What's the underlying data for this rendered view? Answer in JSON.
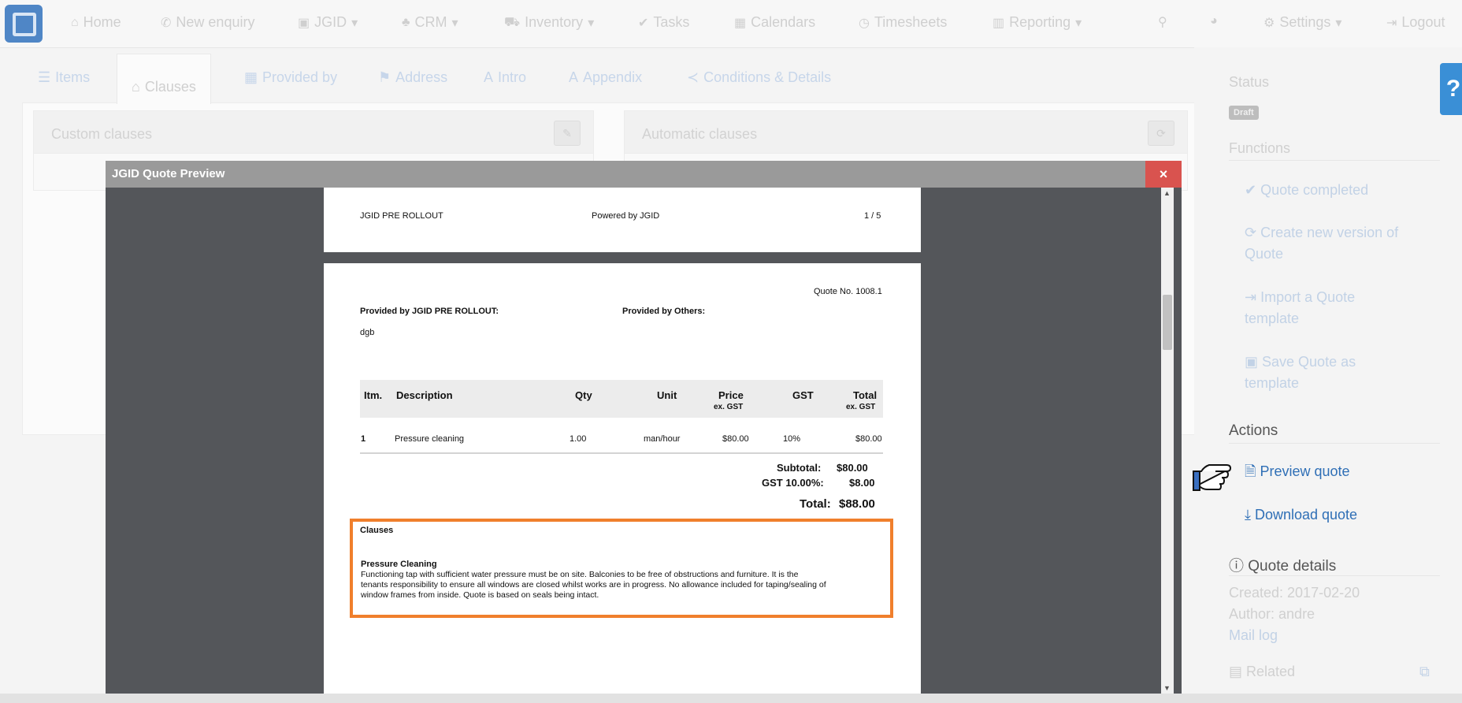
{
  "nav": {
    "items": [
      {
        "icon": "home-icon",
        "label": "Home"
      },
      {
        "icon": "phone-icon",
        "label": "New enquiry"
      },
      {
        "icon": "jgid-icon",
        "label": "JGID"
      },
      {
        "icon": "crm-icon",
        "label": "CRM"
      },
      {
        "icon": "inventory-icon",
        "label": "Inventory"
      },
      {
        "icon": "check-icon",
        "label": "Tasks"
      },
      {
        "icon": "calendar-icon",
        "label": "Calendars"
      },
      {
        "icon": "clock-icon",
        "label": "Timesheets"
      },
      {
        "icon": "chart-icon",
        "label": "Reporting"
      },
      {
        "icon": "gear-icon",
        "label": "Settings"
      },
      {
        "icon": "logout-icon",
        "label": "Logout"
      }
    ]
  },
  "tabs": [
    {
      "icon": "list-icon",
      "label": "Items"
    },
    {
      "icon": "bank-icon",
      "label": "Clauses"
    },
    {
      "icon": "calendar-icon",
      "label": "Provided by"
    },
    {
      "icon": "map-marker-icon",
      "label": "Address"
    },
    {
      "icon": "font-icon",
      "label": "Intro"
    },
    {
      "icon": "font-icon",
      "label": "Appendix"
    },
    {
      "icon": "share-icon",
      "label": "Conditions & Details"
    }
  ],
  "panels": {
    "custom": "Custom clauses",
    "automatic": "Automatic clauses"
  },
  "modal": {
    "title": "JGID Quote Preview",
    "close": "×",
    "header": {
      "left": "JGID PRE ROLLOUT",
      "center": "Powered by JGID",
      "right": "1 / 5"
    },
    "quote_no": "Quote No. 1008.1",
    "provided_by": "Provided by JGID PRE ROLLOUT:",
    "provided_by_value": "dgb",
    "provided_by_others": "Provided by Others:",
    "table": {
      "headers": [
        "Itm.",
        "Description",
        "Qty",
        "Unit",
        "Price",
        "GST",
        "Total"
      ],
      "sub": {
        "price": "ex. GST",
        "total": "ex. GST"
      },
      "rows": [
        [
          "1",
          "Pressure cleaning",
          "1.00",
          "man/hour",
          "$80.00",
          "10%",
          "$80.00"
        ]
      ]
    },
    "totals": {
      "subtotal_label": "Subtotal:",
      "subtotal": "$80.00",
      "gst_label": "GST 10.00%:",
      "gst": "$8.00",
      "total_label": "Total:",
      "total": "$88.00"
    },
    "clauses": {
      "heading": "Clauses",
      "title": "Pressure Cleaning",
      "lines": [
        "Functioning tap with sufficient water pressure must be on site. Balconies to be free of obstructions and furniture. It is the",
        "tenants responsibility to ensure all windows are closed whilst works are in progress. No allowance included for taping/sealing of",
        "window frames from inside. Quote is based on seals being intact."
      ]
    }
  },
  "sidebar": {
    "status_label": "Status",
    "status_badge": "Draft",
    "functions_label": "Functions",
    "functions": [
      {
        "icon": "check-icon",
        "lines": [
          "Quote completed"
        ]
      },
      {
        "icon": "refresh-icon",
        "lines": [
          "Create new version of",
          "Quote"
        ]
      },
      {
        "icon": "import-icon",
        "lines": [
          "Import a Quote",
          "template"
        ]
      },
      {
        "icon": "save-icon",
        "lines": [
          "Save Quote as",
          "template"
        ]
      }
    ],
    "actions_label": "Actions",
    "preview": "Preview quote",
    "download": "Download quote",
    "details_label": "Quote details",
    "created": "Created: 2017-02-20",
    "author": "Author: andre",
    "mail_log": "Mail log",
    "related": "Related"
  }
}
